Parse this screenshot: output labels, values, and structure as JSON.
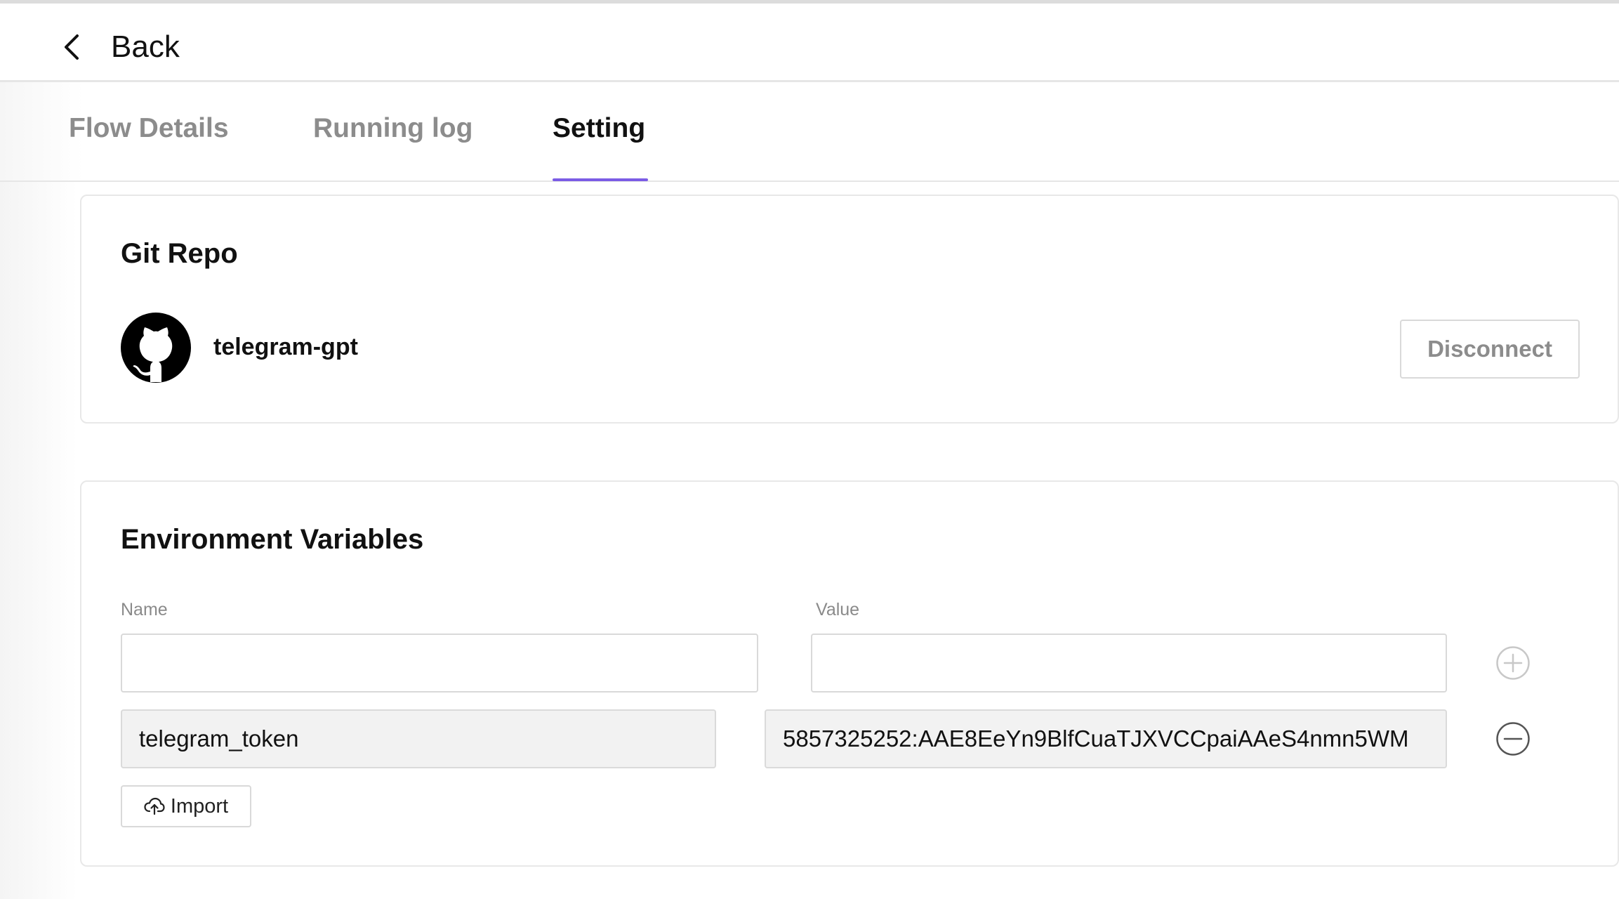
{
  "header": {
    "back_label": "Back"
  },
  "tabs": [
    {
      "label": "Flow Details",
      "active": false
    },
    {
      "label": "Running log",
      "active": false
    },
    {
      "label": "Setting",
      "active": true
    }
  ],
  "git_repo": {
    "title": "Git Repo",
    "repo_name": "telegram-gpt",
    "avatar_icon": "github-icon",
    "disconnect_label": "Disconnect"
  },
  "env_vars": {
    "title": "Environment Variables",
    "name_label": "Name",
    "value_label": "Value",
    "new_name": "",
    "new_value": "",
    "add_icon": "plus-circle-icon",
    "remove_icon": "minus-circle-icon",
    "items": [
      {
        "name": "telegram_token",
        "value": "5857325252:AAE8EeYn9BlfCuaTJXVCCpaiAAeS4nmn5WM"
      }
    ],
    "import_label": "Import",
    "import_icon": "cloud-upload-icon"
  },
  "colors": {
    "accent": "#7b5ce5",
    "muted_text": "#8c8c8c",
    "border": "#d9d9d9"
  }
}
